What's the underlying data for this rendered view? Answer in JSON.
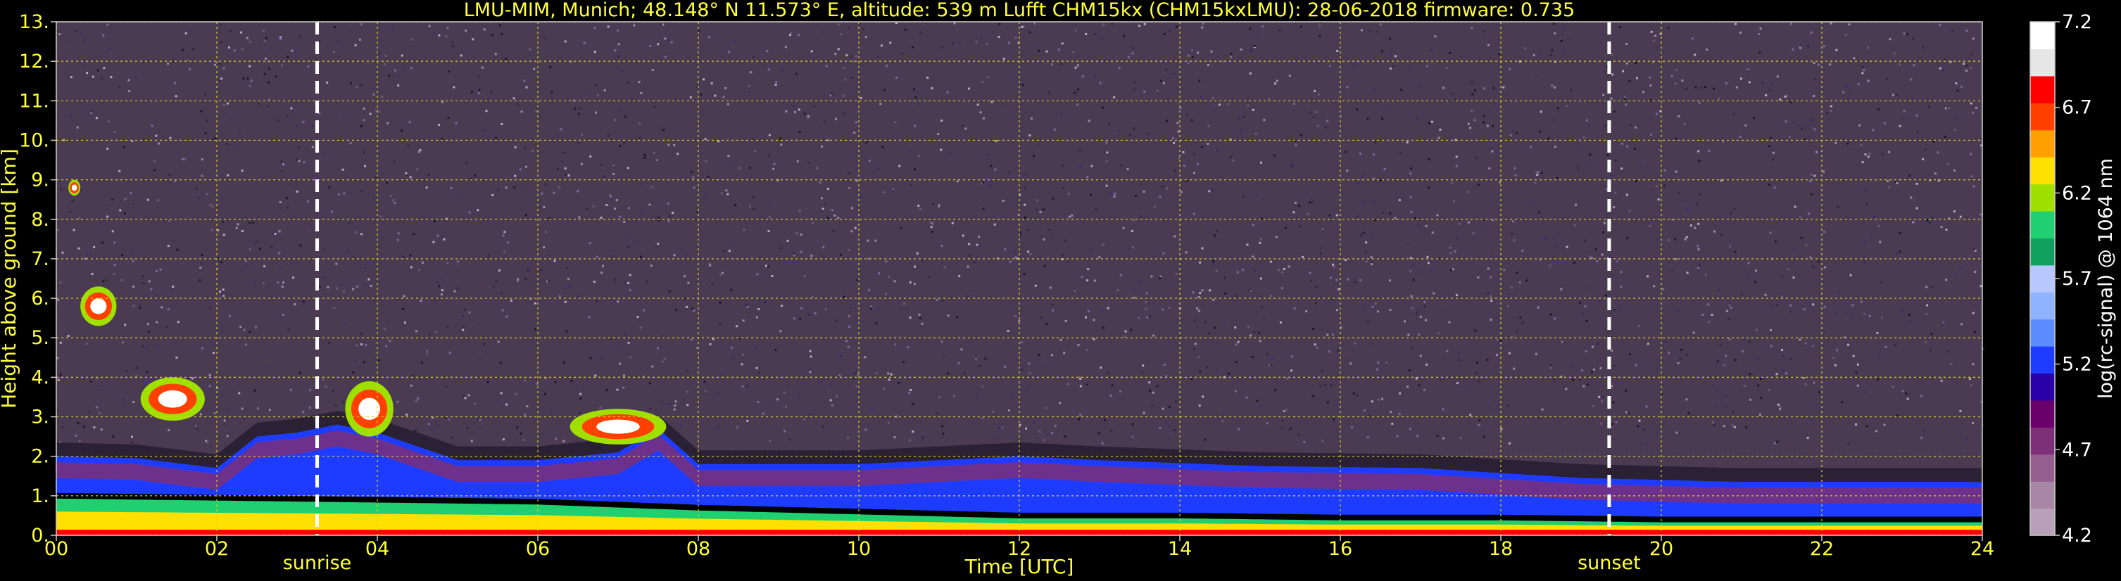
{
  "chart_data": {
    "type": "heatmap",
    "title": "LMU-MIM, Munich; 48.148° N 11.573° E, altitude: 539 m    Lufft CHM15kx (CHM15kxLMU): 28-06-2018    firmware: 0.735",
    "xlabel": "Time [UTC]",
    "ylabel": "Height above ground [km]",
    "xlim": [
      0,
      24
    ],
    "ylim": [
      0,
      13
    ],
    "x_ticks": [
      "00",
      "02",
      "04",
      "06",
      "08",
      "10",
      "12",
      "14",
      "16",
      "18",
      "20",
      "22",
      "24"
    ],
    "y_ticks": [
      "0.",
      "1.",
      "2.",
      "3.",
      "4.",
      "5.",
      "6.",
      "7.",
      "8.",
      "9.",
      "10.",
      "11.",
      "12.",
      "13."
    ],
    "grid": true,
    "colorbar": {
      "label": "log(rc-signal) @ 1064 nm",
      "range": [
        4.2,
        7.2
      ],
      "ticks": [
        "4.2",
        "4.7",
        "5.2",
        "5.7",
        "6.2",
        "6.7",
        "7.2"
      ],
      "colors": [
        "#b8a0b8",
        "#a887a6",
        "#945f8e",
        "#7d2f77",
        "#6a006a",
        "#2a00a8",
        "#1e3cff",
        "#5a8cff",
        "#8fb4ff",
        "#b6c8ff",
        "#10a060",
        "#20d070",
        "#a0e000",
        "#ffe000",
        "#ffa000",
        "#ff4000",
        "#ff0000",
        "#e6e6e6",
        "#ffffff"
      ]
    },
    "events": [
      {
        "name": "sunrise",
        "time_h": 3.25
      },
      {
        "name": "sunset",
        "time_h": 19.35
      }
    ],
    "mixing_layer_top_km": [
      [
        0,
        2.0
      ],
      [
        1,
        1.95
      ],
      [
        2,
        1.7
      ],
      [
        2.5,
        2.5
      ],
      [
        3,
        2.6
      ],
      [
        3.5,
        2.8
      ],
      [
        4,
        2.6
      ],
      [
        5,
        1.9
      ],
      [
        6,
        1.9
      ],
      [
        7,
        2.1
      ],
      [
        7.5,
        2.7
      ],
      [
        8,
        1.8
      ],
      [
        10,
        1.8
      ],
      [
        12,
        2.0
      ],
      [
        13,
        1.9
      ],
      [
        15,
        1.75
      ],
      [
        17,
        1.7
      ],
      [
        19,
        1.45
      ],
      [
        21,
        1.35
      ],
      [
        24,
        1.35
      ]
    ],
    "residual_layer_top_km": [
      [
        0,
        1.0
      ],
      [
        2,
        0.95
      ],
      [
        4,
        0.9
      ],
      [
        6,
        0.85
      ],
      [
        8,
        0.7
      ],
      [
        10,
        0.6
      ],
      [
        12,
        0.5
      ],
      [
        14,
        0.5
      ],
      [
        16,
        0.45
      ],
      [
        18,
        0.45
      ],
      [
        20,
        0.4
      ],
      [
        22,
        0.4
      ],
      [
        24,
        0.4
      ]
    ],
    "cloud_features": [
      {
        "time_h": [
          1.05,
          1.85
        ],
        "height_km": [
          2.9,
          4.0
        ]
      },
      {
        "time_h": [
          0.3,
          0.75
        ],
        "height_km": [
          5.3,
          6.3
        ]
      },
      {
        "time_h": [
          0.15,
          0.3
        ],
        "height_km": [
          8.6,
          9.0
        ]
      },
      {
        "time_h": [
          3.6,
          4.2
        ],
        "height_km": [
          2.5,
          3.9
        ]
      },
      {
        "time_h": [
          6.4,
          7.6
        ],
        "height_km": [
          2.3,
          3.2
        ]
      }
    ]
  }
}
